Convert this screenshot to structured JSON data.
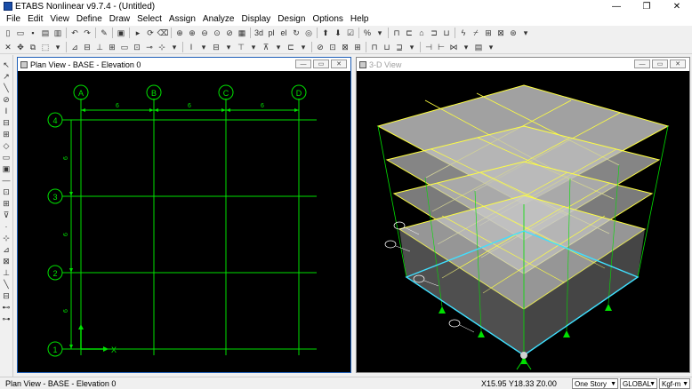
{
  "window": {
    "title": "ETABS Nonlinear v9.7.4 - (Untitled)",
    "min": "—",
    "max": "❐",
    "close": "✕"
  },
  "menu": [
    "File",
    "Edit",
    "View",
    "Define",
    "Draw",
    "Select",
    "Assign",
    "Analyze",
    "Display",
    "Design",
    "Options",
    "Help"
  ],
  "toolbar": {
    "label_3d": "3d",
    "label_pl": "pl",
    "label_el": "el",
    "label_percent": "%"
  },
  "plan_view": {
    "title": "Plan View - BASE - Elevation 0",
    "grid_x": [
      "A",
      "B",
      "C",
      "D"
    ],
    "grid_y": [
      "4",
      "3",
      "2",
      "1"
    ],
    "x_spacing": [
      "6",
      "6",
      "6"
    ],
    "y_spacing": [
      "6",
      "6",
      "6"
    ],
    "axis_label": "X",
    "grid_color": "#00e000"
  },
  "three_d_view": {
    "title": "3-D View",
    "slab_color": "#bdbdbd",
    "beam_color": "#ffff40",
    "selected_color": "#40e0ff"
  },
  "status": {
    "left": "Plan View - BASE - Elevation 0",
    "coords": "X15.95  Y18.33  Z0.00",
    "story_select": "One Story",
    "coord_system": "GLOBAL",
    "units": "Kgf-m"
  }
}
